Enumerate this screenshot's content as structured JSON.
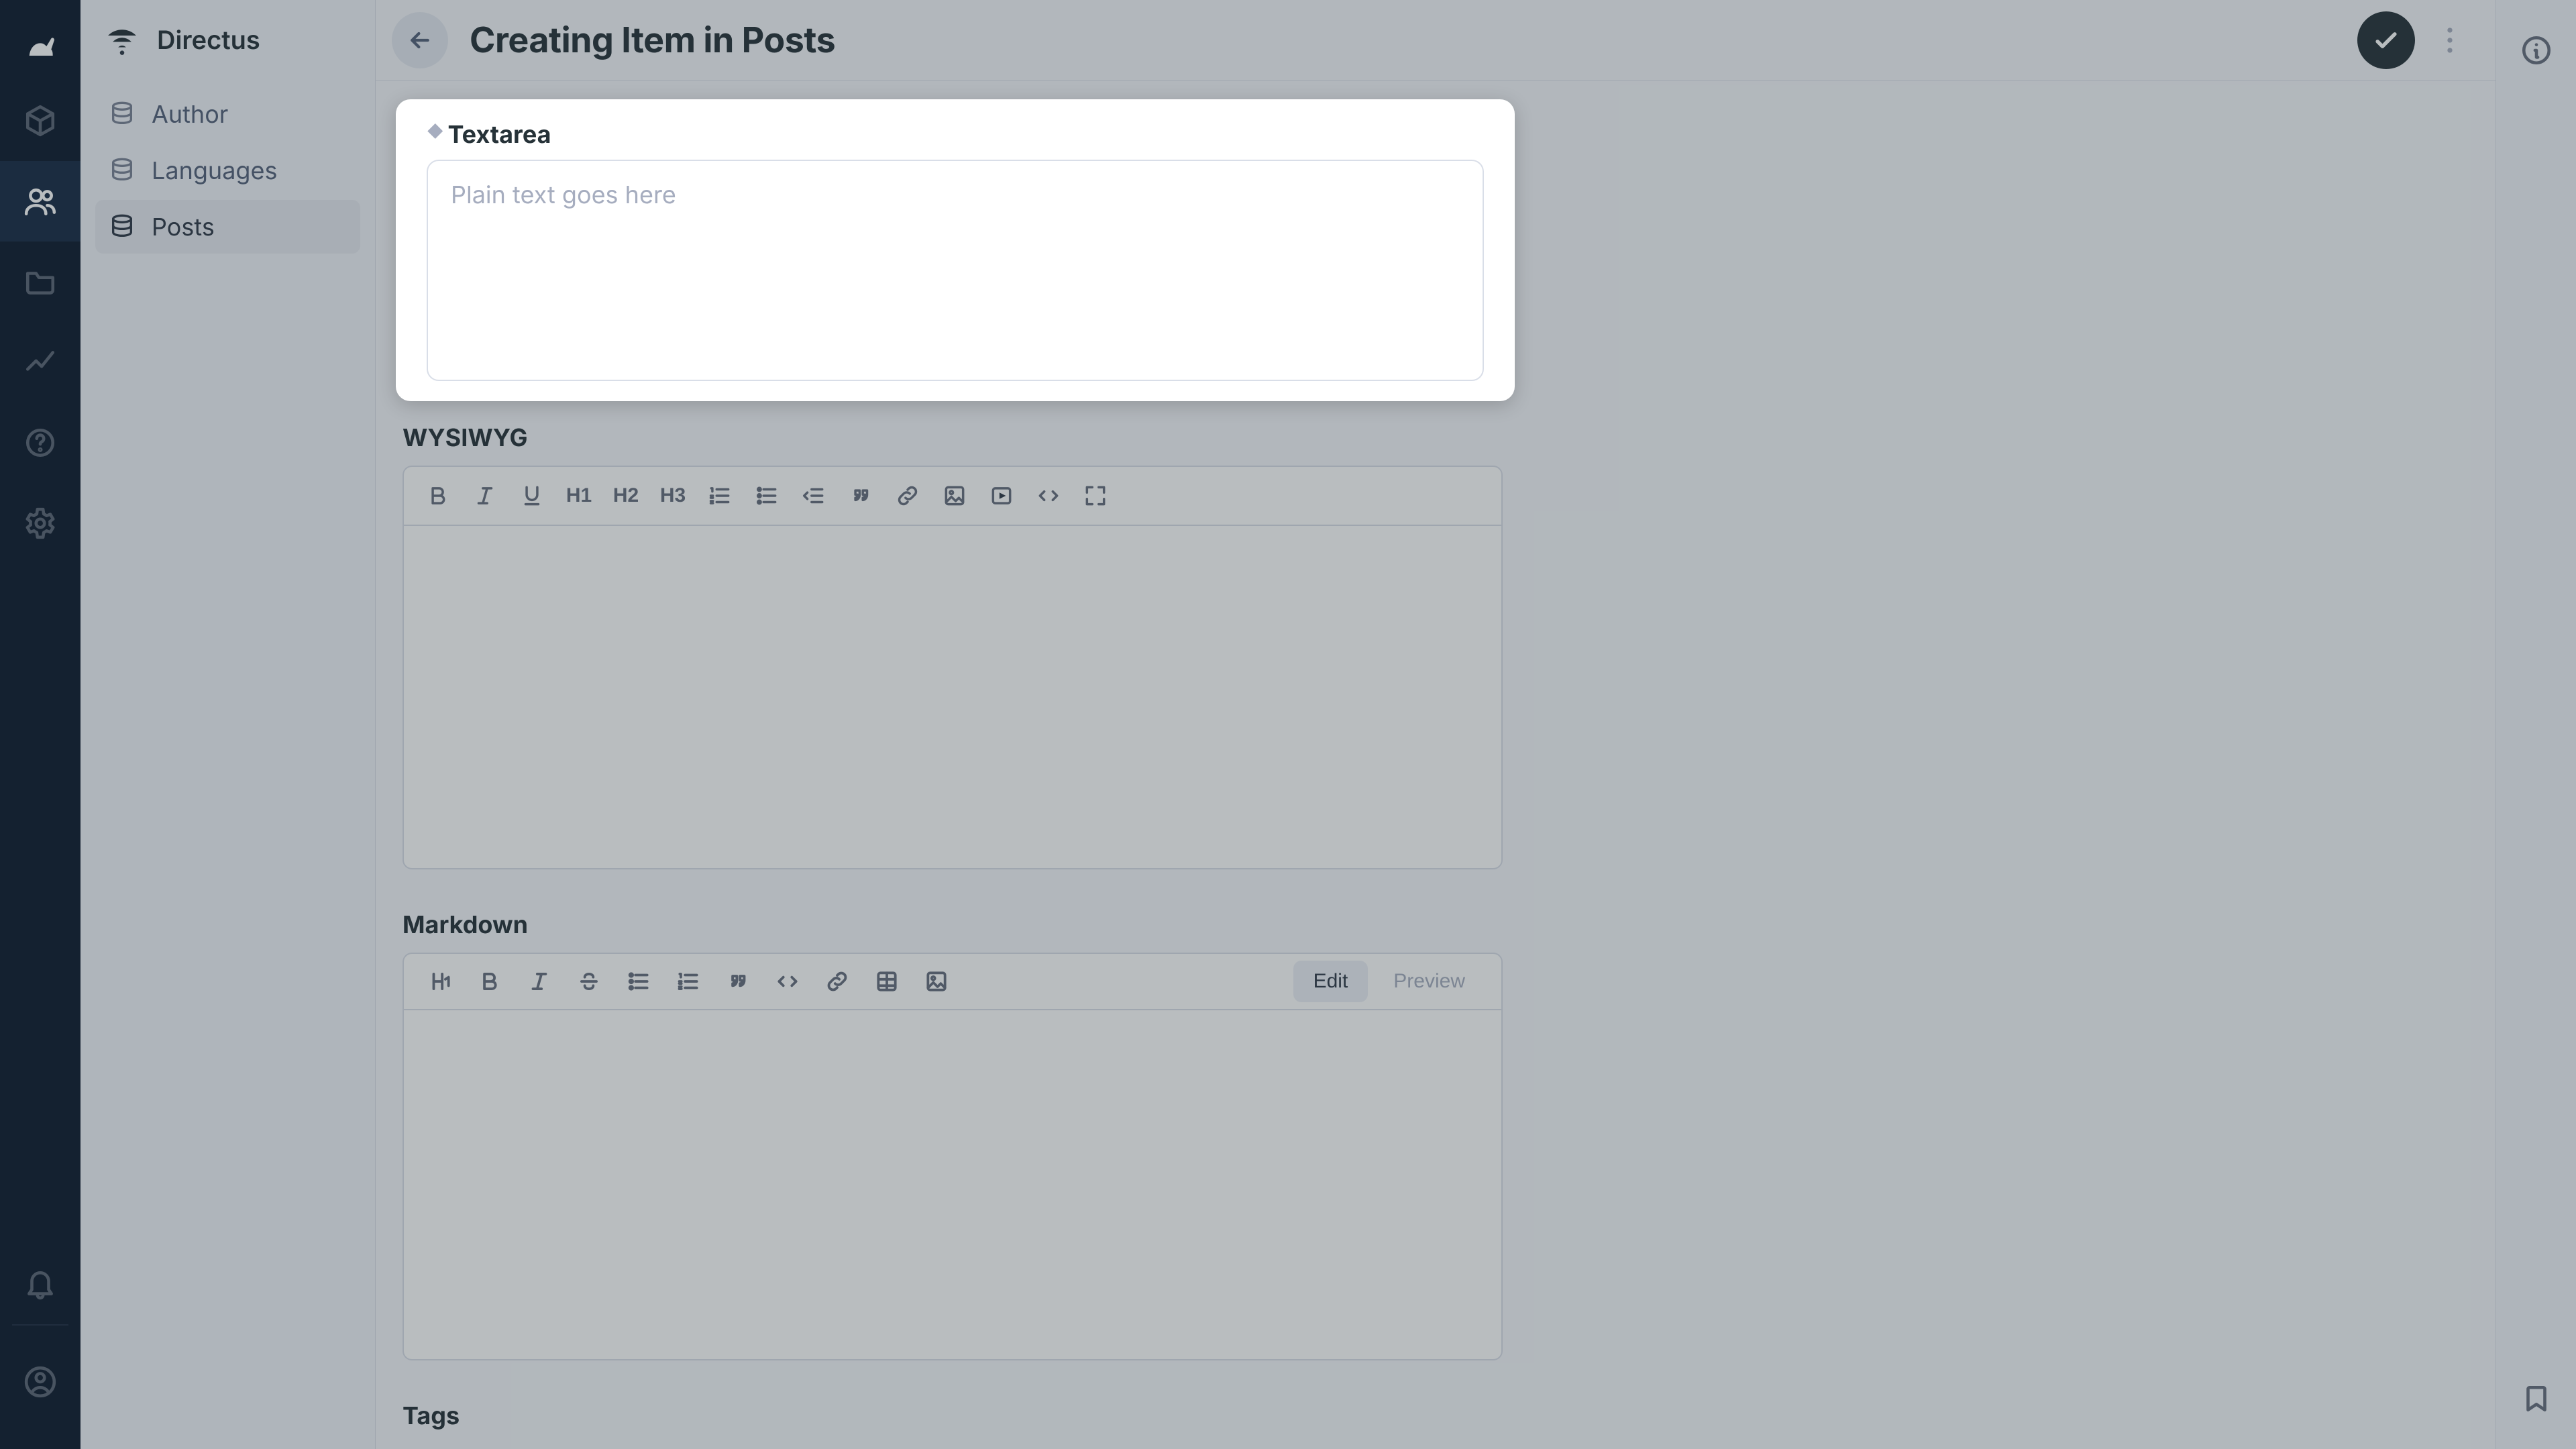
{
  "brand": {
    "name": "Directus"
  },
  "rail": {
    "items": [
      {
        "name": "content",
        "active": false
      },
      {
        "name": "users",
        "active": true
      },
      {
        "name": "files",
        "active": false
      },
      {
        "name": "insights",
        "active": false
      },
      {
        "name": "docs",
        "active": false
      },
      {
        "name": "settings",
        "active": false
      }
    ],
    "bottom": [
      {
        "name": "notifications"
      }
    ]
  },
  "collections": {
    "items": [
      {
        "key": "author",
        "label": "Author",
        "active": false
      },
      {
        "key": "languages",
        "label": "Languages",
        "active": false
      },
      {
        "key": "posts",
        "label": "Posts",
        "active": true
      }
    ]
  },
  "header": {
    "title": "Creating Item in Posts"
  },
  "fields": {
    "textarea": {
      "label": "Textarea",
      "required": true,
      "placeholder": "Plain text goes here",
      "value": ""
    },
    "wysiwyg": {
      "label": "WYSIWYG",
      "toolbar": [
        {
          "name": "bold"
        },
        {
          "name": "italic"
        },
        {
          "name": "underline"
        },
        {
          "name": "h1",
          "text": "H1"
        },
        {
          "name": "h2",
          "text": "H2"
        },
        {
          "name": "h3",
          "text": "H3"
        },
        {
          "name": "ol"
        },
        {
          "name": "ul"
        },
        {
          "name": "outdent"
        },
        {
          "name": "quote"
        },
        {
          "name": "link"
        },
        {
          "name": "image"
        },
        {
          "name": "video"
        },
        {
          "name": "code"
        },
        {
          "name": "fullscreen"
        }
      ]
    },
    "markdown": {
      "label": "Markdown",
      "toolbar": [
        {
          "name": "heading"
        },
        {
          "name": "bold"
        },
        {
          "name": "italic"
        },
        {
          "name": "strike"
        },
        {
          "name": "ul"
        },
        {
          "name": "ol"
        },
        {
          "name": "quote"
        },
        {
          "name": "code"
        },
        {
          "name": "link"
        },
        {
          "name": "table"
        },
        {
          "name": "image"
        }
      ],
      "segments": {
        "edit": "Edit",
        "preview": "Preview",
        "active": "edit"
      }
    },
    "tags": {
      "label": "Tags"
    }
  },
  "info_rail": {
    "top": "info",
    "bottom": "bookmark"
  }
}
